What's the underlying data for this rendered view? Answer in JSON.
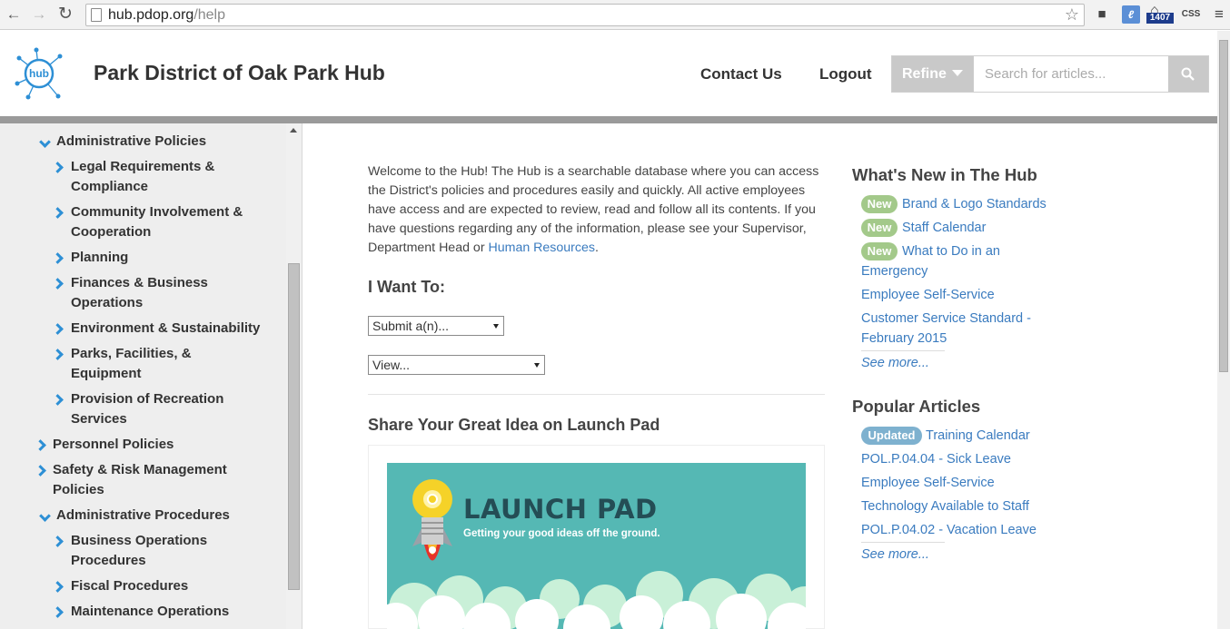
{
  "browser": {
    "url_host": "hub.pdop.org",
    "url_path": "/help",
    "ext_counter": "1407",
    "ext_css": "CSS"
  },
  "header": {
    "logo_text": "hub",
    "title": "Park District of Oak Park Hub",
    "contact": "Contact Us",
    "logout": "Logout",
    "refine": "Refine",
    "search_placeholder": "Search for articles..."
  },
  "sidebar": {
    "items": [
      {
        "label": "Administrative Policies"
      },
      {
        "label": "Legal Requirements &",
        "label2": "Compliance"
      },
      {
        "label": "Community Involvement &",
        "label2": "Cooperation"
      },
      {
        "label": "Planning"
      },
      {
        "label": "Finances & Business",
        "label2": "Operations"
      },
      {
        "label": "Environment & Sustainability"
      },
      {
        "label": "Parks, Facilities, &",
        "label2": "Equipment"
      },
      {
        "label": "Provision of Recreation",
        "label2": "Services"
      },
      {
        "label": "Personnel Policies"
      },
      {
        "label": "Safety & Risk Management",
        "label2": "Policies"
      },
      {
        "label": "Administrative Procedures"
      },
      {
        "label": "Business Operations",
        "label2": "Procedures"
      },
      {
        "label": "Fiscal Procedures"
      },
      {
        "label": "Maintenance Operations"
      }
    ]
  },
  "main": {
    "intro": "Welcome to the Hub! The Hub is a searchable database where you can access the District's policies and procedures easily and quickly. All active employees have access and are expected to review, read and follow all its contents. If you have questions regarding any of the information, please see your Supervisor, Department Head or ",
    "intro_link": "Human Resources",
    "intro_end": ".",
    "want_heading": "I Want To:",
    "submit_select": "Submit a(n)...",
    "view_select": "View...",
    "launch_heading": "Share Your Great Idea on Launch Pad",
    "banner_title": "LAUNCH PAD",
    "banner_sub": "Getting your good ideas off the ground."
  },
  "right": {
    "whats_new_heading": "What's New in The Hub",
    "new_badge": "New",
    "new_items": [
      "Brand & Logo Standards",
      "Staff Calendar",
      "What to Do in an",
      "Emergency",
      "Employee Self-Service",
      "Customer Service Standard -",
      "February 2015"
    ],
    "see_more": "See more...",
    "popular_heading": "Popular Articles",
    "updated_badge": "Updated",
    "popular_items": [
      "Training Calendar",
      "POL.P.04.04 - Sick Leave",
      "Employee Self-Service",
      "Technology Available to Staff",
      "POL.P.04.02 - Vacation Leave"
    ]
  },
  "colors": {
    "accent_blue": "#2d8fd5",
    "link": "#3a7bbf",
    "new_badge": "#a3c98a",
    "updated_badge": "#7eb1cf",
    "banner_bg": "#55b8b4"
  }
}
